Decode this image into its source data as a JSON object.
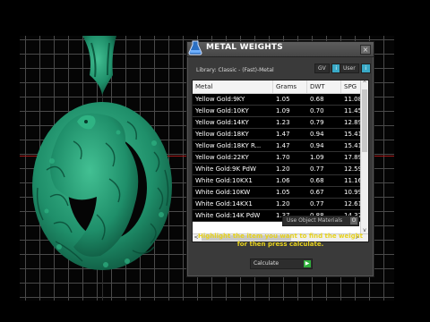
{
  "dialog": {
    "title": "METAL WEIGHTS",
    "close_glyph": "×",
    "library": "Library: Classic - (Fast)-Metal",
    "gv_label": "GV",
    "gv_indicator": "i",
    "user_label": "User",
    "user_indicator": "i"
  },
  "table": {
    "headers": [
      "Metal",
      "Grams",
      "DWT",
      "SPG"
    ],
    "rows": [
      [
        "Yellow Gold:9KY",
        "1.05",
        "0.68",
        "11.08"
      ],
      [
        "Yellow Gold:10KY",
        "1.09",
        "0.70",
        "11.45"
      ],
      [
        "Yellow Gold:14KY",
        "1.23",
        "0.79",
        "12.89"
      ],
      [
        "Yellow Gold:18KY",
        "1.47",
        "0.94",
        "15.41"
      ],
      [
        "Yellow Gold:18KY R...",
        "1.47",
        "0.94",
        "15.41"
      ],
      [
        "Yellow Gold:22KY",
        "1.70",
        "1.09",
        "17.89"
      ],
      [
        "White Gold:9K PdW",
        "1.20",
        "0.77",
        "12.59"
      ],
      [
        "White Gold:10KX1",
        "1.06",
        "0.68",
        "11.16"
      ],
      [
        "White Gold:10KW",
        "1.05",
        "0.67",
        "10.99"
      ],
      [
        "White Gold:14KX1",
        "1.20",
        "0.77",
        "12.61"
      ],
      [
        "White Gold:14K PdW",
        "1.37",
        "0.88",
        "14.37"
      ]
    ],
    "scroll_up": "^",
    "scroll_down": "v",
    "scroll_left": "<",
    "scroll_right": ">"
  },
  "use_object_materials": {
    "label": "Use Object Materials",
    "indicator": "O"
  },
  "instruction": "Highlight the item you want to find the weight for then press calculate.",
  "calculate": {
    "label": "Calculate",
    "arrow": "▶"
  },
  "colors": {
    "model_green": "#1f8f6a",
    "instruction_yellow": "#e8d31e",
    "indicator_blue": "#39a9c6",
    "calculate_green": "#2fae3b"
  }
}
